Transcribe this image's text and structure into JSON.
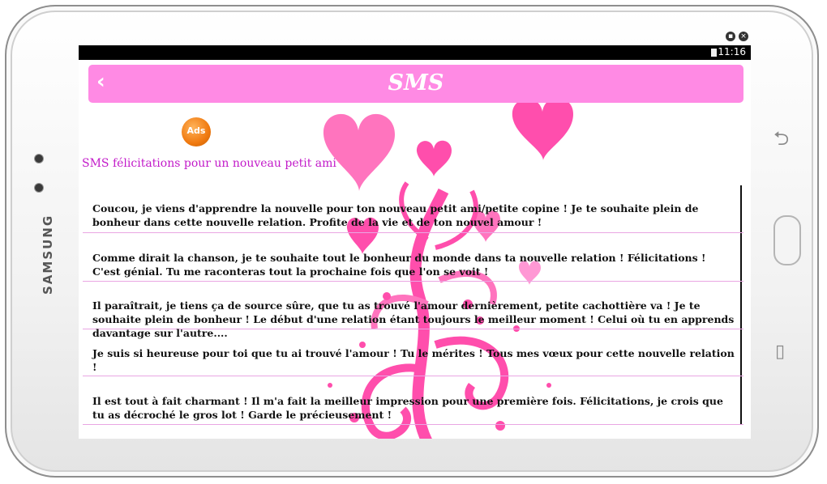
{
  "device": {
    "brand": "SAMSUNG"
  },
  "status_bar": {
    "time": "11:16"
  },
  "app_bar": {
    "back_icon": "‹",
    "title": "SMS"
  },
  "ads_badge": "Ads",
  "section_title": "SMS félicitations pour un nouveau petit ami",
  "messages": [
    "Coucou, je viens d'apprendre la nouvelle pour ton nouveau petit ami/petite copine ! Je te souhaite plein de bonheur dans cette nouvelle relation. Profite de la vie et de ton nouvel amour !",
    "Comme dirait la chanson, je te souhaite tout le bonheur du monde dans ta nouvelle relation ! Félicitations ! C'est génial. Tu me raconteras tout la prochaine fois que l'on se voit !",
    "Il paraîtrait, je tiens ça de source sûre, que tu as trouvé l'amour dernièrement, petite cachottière va ! Je te souhaite plein de bonheur ! Le début d'une relation étant toujours le meilleur moment ! Celui où tu en apprends davantage sur l'autre....",
    "Je suis si heureuse pour toi que tu ai trouvé l'amour ! Tu le mérites ! Tous mes vœux pour cette nouvelle relation !",
    "Il est tout à fait charmant ! Il m'a fait la meilleur impression pour une première fois. Félicitations, je crois que tu as décroché le gros lot ! Garde le précieusement !"
  ],
  "colors": {
    "appbar": "#ff8ae4",
    "accent_text": "#c21ac9",
    "divider": "#e9a6e3",
    "decoration": "#ff3fa6"
  }
}
